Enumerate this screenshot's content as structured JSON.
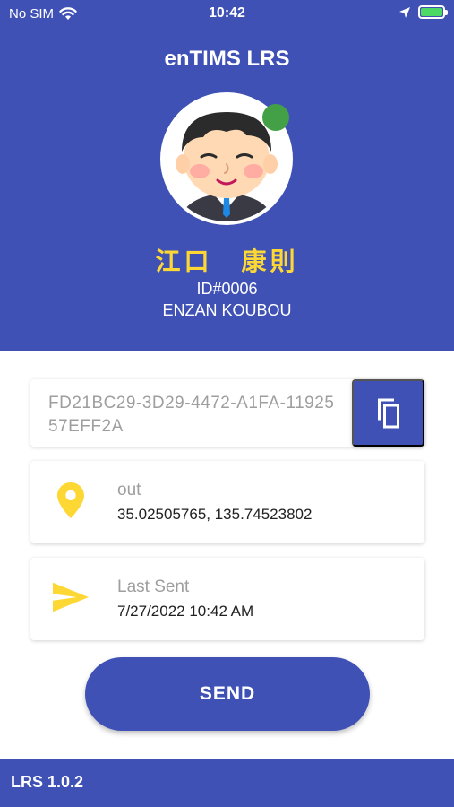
{
  "status_bar": {
    "carrier": "No SIM",
    "time": "10:42"
  },
  "header": {
    "title": "enTIMS LRS",
    "user_name": "江口　康則",
    "user_id": "ID#0006",
    "organization": "ENZAN KOUBOU",
    "online_color": "#43a047"
  },
  "device": {
    "uuid": "FD21BC29-3D29-4472-A1FA-1192557EFF2A",
    "copy_icon": "copy-icon"
  },
  "location": {
    "label": "out",
    "coordinates": "35.02505765, 135.74523802",
    "icon": "location-pin-icon"
  },
  "last_sent": {
    "label": "Last Sent",
    "timestamp": "7/27/2022 10:42 AM",
    "icon": "send-icon"
  },
  "send_button": {
    "label": "SEND"
  },
  "footer": {
    "version": "LRS 1.0.2"
  },
  "colors": {
    "primary": "#3f51b5",
    "accent": "#fdd835",
    "battery": "#4cd964"
  }
}
